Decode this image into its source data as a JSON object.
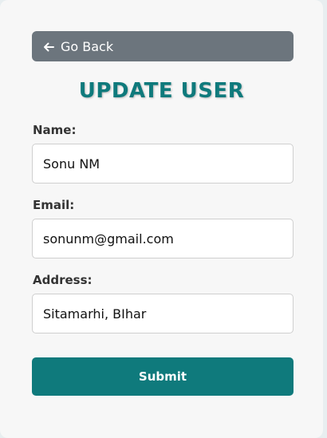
{
  "back_button": {
    "label": "Go Back"
  },
  "title": "UPDATE USER",
  "form": {
    "name": {
      "label": "Name:",
      "value": "Sonu NM"
    },
    "email": {
      "label": "Email:",
      "value": "sonunm@gmail.com"
    },
    "address": {
      "label": "Address:",
      "value": "Sitamarhi, BIhar"
    },
    "submit_label": "Submit"
  },
  "colors": {
    "accent": "#0f7a7c",
    "back_button": "#6c757d",
    "card_bg": "#f7f7f7"
  },
  "icons": {
    "back": "arrow-left-icon"
  }
}
